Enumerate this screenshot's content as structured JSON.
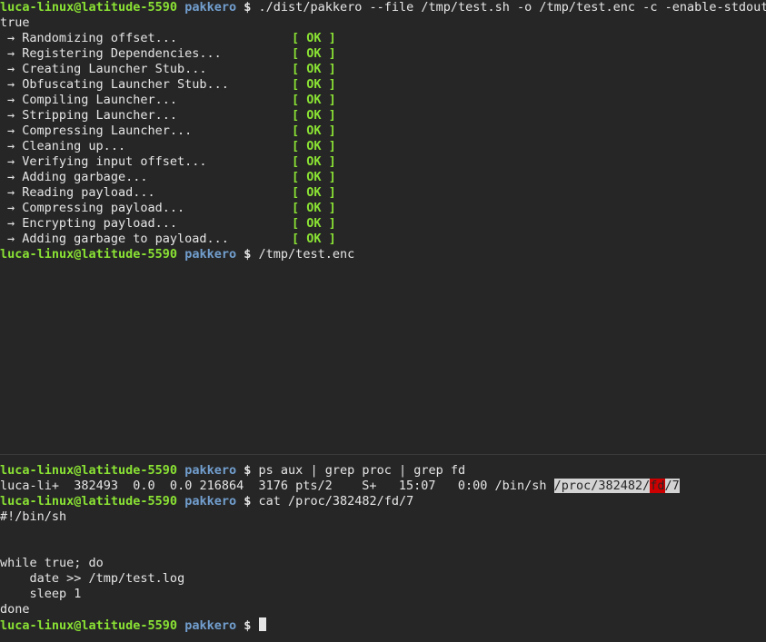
{
  "prompt": {
    "user_host": "luca-linux@latitude-5590",
    "dir": "pakkero",
    "symbol": "$"
  },
  "top": {
    "command": "./dist/pakkero --file /tmp/test.sh -o /tmp/test.enc -c -enable-stdout",
    "output_first": "true",
    "arrow": "→",
    "status_label": "[ OK ]",
    "steps": [
      "Randomizing offset...",
      "Registering Dependencies...",
      "Creating Launcher Stub...",
      "Obfuscating Launcher Stub...",
      "Compiling Launcher...",
      "Stripping Launcher...",
      "Compressing Launcher...",
      "Cleaning up...",
      "Verifying input offset...",
      "Adding garbage...",
      "Reading payload...",
      "Compressing payload...",
      "Encrypting payload...",
      "Adding garbage to payload..."
    ],
    "second_command": "/tmp/test.enc"
  },
  "bottom": {
    "command1": "ps aux | grep proc | grep fd",
    "ps_line_prefix": "luca-li+  382493  0.0  0.0 216864  3176 pts/2    S+   15:07   0:00 /bin/sh ",
    "ps_line_path_a": "/proc/382482/",
    "ps_line_path_fd": "fd",
    "ps_line_path_b": "/7",
    "command2": "cat /proc/382482/fd/7",
    "file_lines": [
      "#!/bin/sh",
      "",
      "",
      "while true; do",
      "    date >> /tmp/test.log",
      "    sleep 1",
      "done"
    ]
  },
  "colors": {
    "background": "#262626",
    "prompt_user": "#8ae234",
    "prompt_dir": "#729fcf",
    "ok": "#8ae234",
    "highlight_fd": "#cc0000"
  }
}
